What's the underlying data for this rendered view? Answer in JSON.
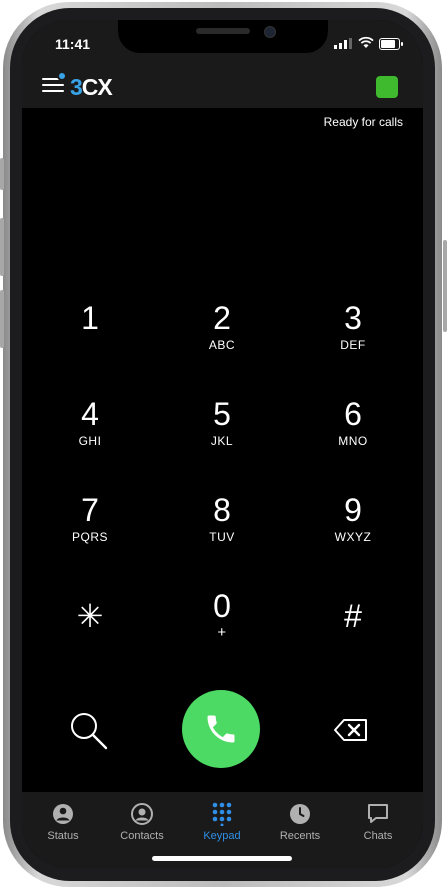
{
  "status_bar": {
    "time": "11:41"
  },
  "header": {
    "logo_prefix": "3",
    "logo_suffix": "CX",
    "presence_color": "#3fba2f"
  },
  "status_text": "Ready for calls",
  "keypad": {
    "keys": [
      {
        "digit": "1",
        "letters": ""
      },
      {
        "digit": "2",
        "letters": "ABC"
      },
      {
        "digit": "3",
        "letters": "DEF"
      },
      {
        "digit": "4",
        "letters": "GHI"
      },
      {
        "digit": "5",
        "letters": "JKL"
      },
      {
        "digit": "6",
        "letters": "MNO"
      },
      {
        "digit": "7",
        "letters": "PQRS"
      },
      {
        "digit": "8",
        "letters": "TUV"
      },
      {
        "digit": "9",
        "letters": "WXYZ"
      },
      {
        "digit": "✳",
        "letters": ""
      },
      {
        "digit": "0",
        "letters": "+"
      },
      {
        "digit": "#",
        "letters": ""
      }
    ]
  },
  "actions": {
    "search_icon": "search-icon",
    "call_icon": "phone-icon",
    "backspace_icon": "backspace-icon",
    "call_color": "#4cd964"
  },
  "tabs": [
    {
      "label": "Status",
      "icon": "status-icon"
    },
    {
      "label": "Contacts",
      "icon": "contacts-icon"
    },
    {
      "label": "Keypad",
      "icon": "keypad-icon",
      "active": true
    },
    {
      "label": "Recents",
      "icon": "clock-icon"
    },
    {
      "label": "Chats",
      "icon": "chat-icon"
    }
  ],
  "colors": {
    "accent": "#2f8fe6",
    "brand_blue": "#39a3e8"
  }
}
